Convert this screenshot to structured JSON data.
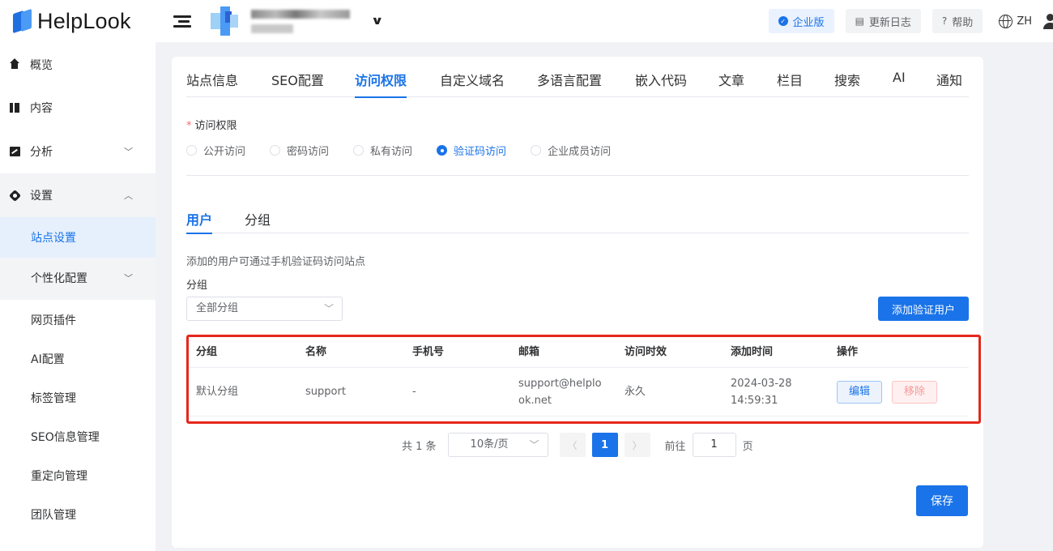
{
  "header": {
    "logo_text": "HelpLook",
    "enterprise_label": "企业版",
    "changelog_label": "更新日志",
    "help_label": "帮助",
    "lang_label": "ZH"
  },
  "sidebar": {
    "items": [
      {
        "label": "概览",
        "icon": "home-icon"
      },
      {
        "label": "内容",
        "icon": "content-icon"
      },
      {
        "label": "分析",
        "icon": "analytics-icon"
      },
      {
        "label": "设置",
        "icon": "gear-icon"
      },
      {
        "label": "站点设置"
      },
      {
        "label": "个性化配置"
      },
      {
        "label": "网页插件"
      },
      {
        "label": "AI配置"
      },
      {
        "label": "标签管理"
      },
      {
        "label": "SEO信息管理"
      },
      {
        "label": "重定向管理"
      },
      {
        "label": "团队管理"
      }
    ]
  },
  "tabs": [
    "站点信息",
    "SEO配置",
    "访问权限",
    "自定义域名",
    "多语言配置",
    "嵌入代码",
    "文章",
    "栏目",
    "搜索",
    "AI",
    "通知"
  ],
  "active_tab": "访问权限",
  "access": {
    "label": "访问权限",
    "options": [
      "公开访问",
      "密码访问",
      "私有访问",
      "验证码访问",
      "企业成员访问"
    ],
    "selected": "验证码访问"
  },
  "subtabs": [
    "用户",
    "分组"
  ],
  "active_subtab": "用户",
  "description": "添加的用户可通过手机验证码访问站点",
  "group_filter": {
    "label": "分组",
    "value": "全部分组"
  },
  "add_button": "添加验证用户",
  "table": {
    "headers": [
      "分组",
      "名称",
      "手机号",
      "邮箱",
      "访问时效",
      "添加时间",
      "操作"
    ],
    "rows": [
      {
        "group": "默认分组",
        "name": "support",
        "phone": "-",
        "email": "support@helplook.net",
        "validity": "永久",
        "added_date": "2024-03-28",
        "added_time": "14:59:31",
        "edit": "编辑",
        "remove": "移除"
      }
    ]
  },
  "pagination": {
    "total": "共 1 条",
    "page_size": "10条/页",
    "current_page": "1",
    "goto_label": "前往",
    "goto_value": "1",
    "page_unit": "页"
  },
  "save_button": "保存",
  "colors": {
    "primary": "#1a73e8",
    "danger": "#f56c6c",
    "highlight_box": "#e5271c"
  }
}
